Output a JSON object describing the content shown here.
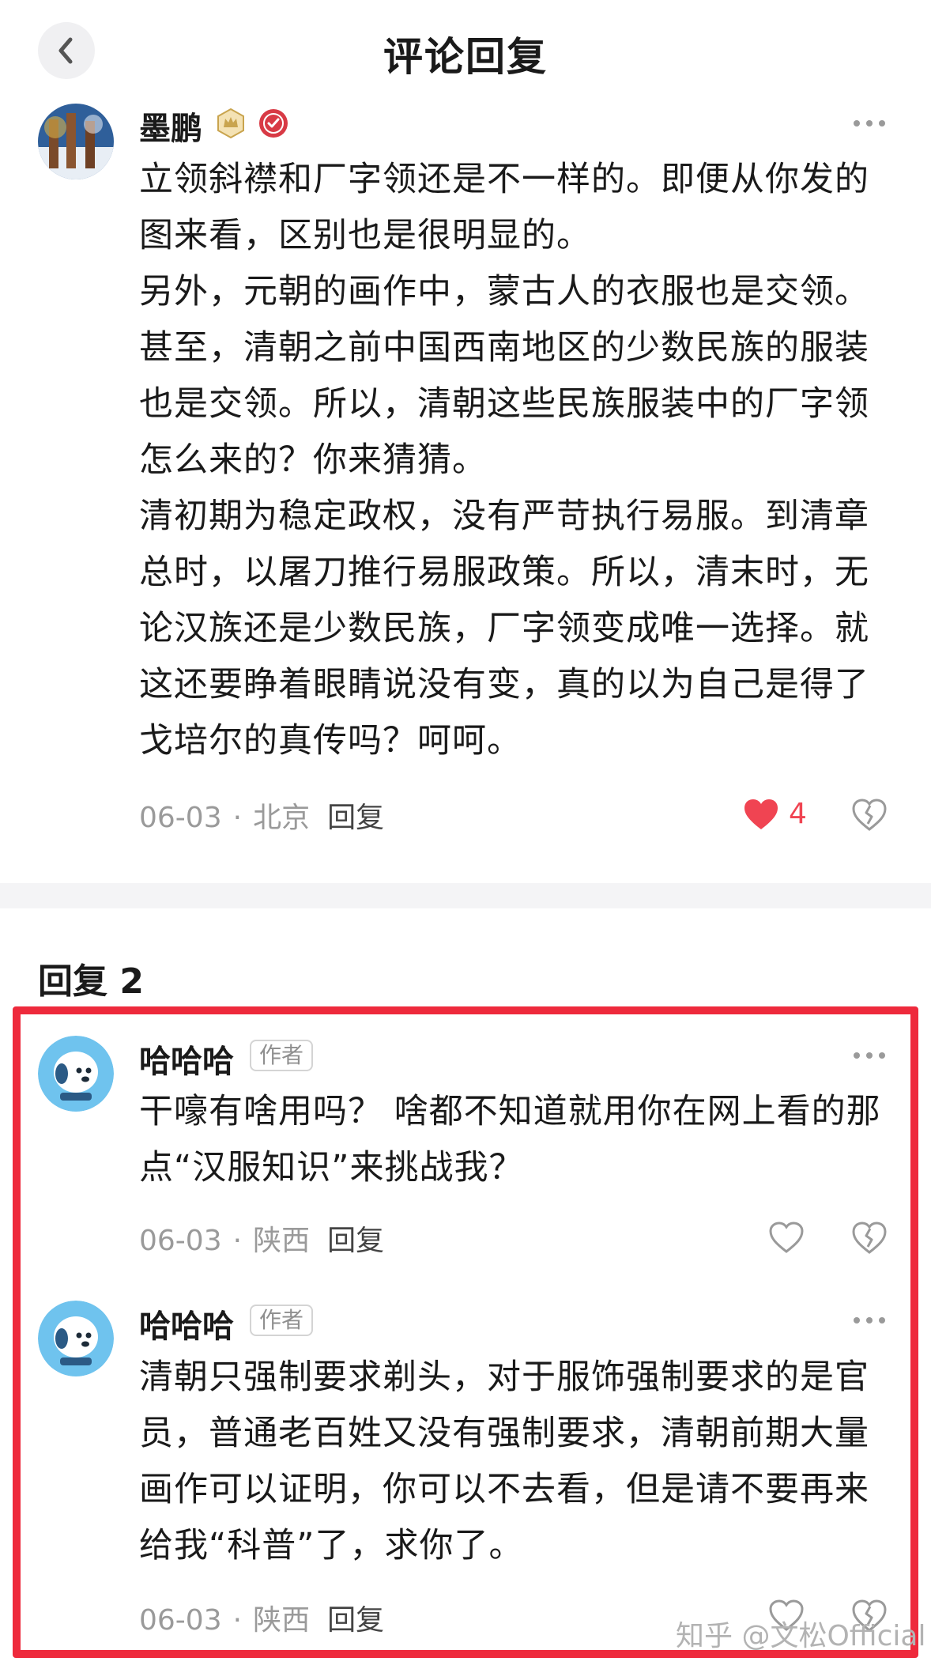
{
  "header": {
    "title": "评论回复"
  },
  "main_comment": {
    "author": "墨鹏",
    "paragraphs": [
      "立领斜襟和厂字领还是不一样的。即便从你发的图来看，区别也是很明显的。",
      "另外，元朝的画作中，蒙古人的衣服也是交领。甚至，清朝之前中国西南地区的少数民族的服装也是交领。所以，清朝这些民族服装中的厂字领怎么来的？你来猜猜。",
      "清初期为稳定政权，没有严苛执行易服。到清章总时，以屠刀推行易服政策。所以，清末时，无论汉族还是少数民族，厂字领变成唯一选择。就这还要睁着眼睛说没有变，真的以为自己是得了戈培尔的真传吗？呵呵。"
    ],
    "date": "06-03",
    "separator": "·",
    "location": "北京",
    "reply_label": "回复",
    "likes": "4",
    "liked": true
  },
  "replies_section": {
    "title": "回复 2"
  },
  "replies": [
    {
      "author": "哈哈哈",
      "tag": "作者",
      "paragraphs": [
        "干嚎有啥用吗？ 啥都不知道就用你在网上看的那点“汉服知识”来挑战我？"
      ],
      "date": "06-03",
      "separator": "·",
      "location": "陕西",
      "reply_label": "回复"
    },
    {
      "author": "哈哈哈",
      "tag": "作者",
      "paragraphs": [
        "清朝只强制要求剃头，对于服饰强制要求的是官员，普通老百姓又没有强制要求，清朝前期大量画作可以证明，你可以不去看，但是请不要再来给我“科普”了，求你了。"
      ],
      "date": "06-03",
      "separator": "·",
      "location": "陕西",
      "reply_label": "回复"
    }
  ],
  "watermark": "知乎 @文松Official",
  "colors": {
    "like_active": "#f04452",
    "highlight_border": "#ee2a3c",
    "meta_text": "#9a9a9a"
  }
}
